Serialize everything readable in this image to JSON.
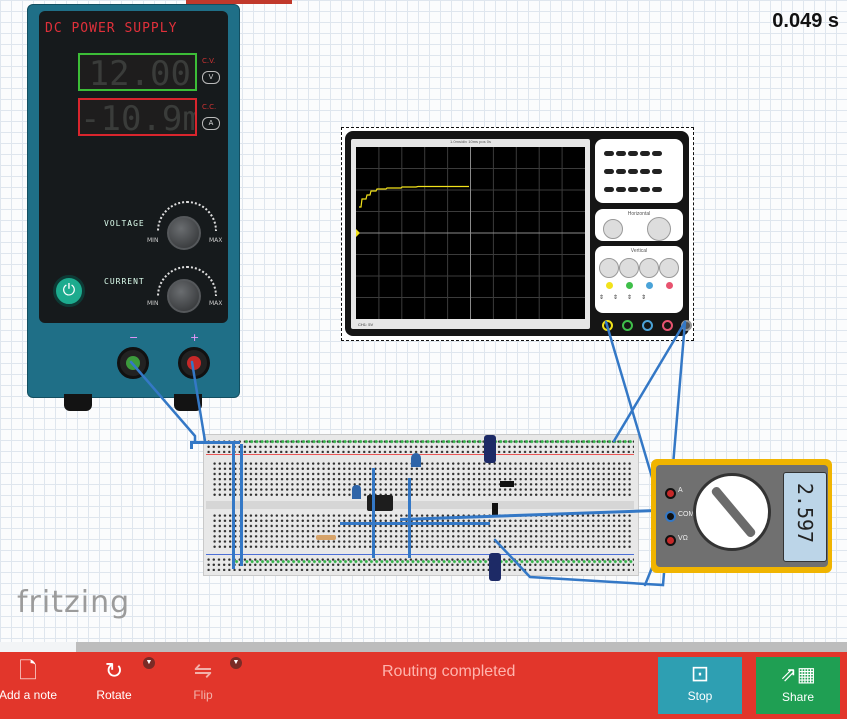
{
  "timer": {
    "value": "0.049 s"
  },
  "power_supply": {
    "title": "DC POWER SUPPLY",
    "voltage_display": "12.00",
    "current_display": "-10.9m",
    "voltage_mode": "C.V.",
    "voltage_unit": "V",
    "current_mode": "C.C.",
    "current_unit": "A",
    "voltage_knob_label": "VOLTAGE",
    "current_knob_label": "CURRENT",
    "min_label": "MIN",
    "max_label": "MAX",
    "minus_label": "−",
    "plus_label": "+",
    "power_icon": "power-icon"
  },
  "oscilloscope": {
    "header": "1.0ms/div  10ms  pos 0s",
    "footer": "CH1: 5V",
    "horizontal_label": "Horizontal",
    "vertical_label": "Vertical",
    "channels": [
      "1",
      "2",
      "3",
      "4"
    ],
    "channel_colors": [
      "#f2e21b",
      "#3fbf4a",
      "#4aa3d8",
      "#e8536f"
    ]
  },
  "multimeter": {
    "reading": "2.597",
    "labels": {
      "amps": "A",
      "com": "COM",
      "volt": "VΩ"
    }
  },
  "logo": {
    "text": "fritzing"
  },
  "toolbar": {
    "add_note": "Add a note",
    "rotate": "Rotate",
    "flip": "Flip",
    "status": "Routing completed",
    "stop": "Stop",
    "share": "Share"
  },
  "colors": {
    "toolbar": "#e2362b",
    "stop_button": "#2e9fb2",
    "share_button": "#1f9f53",
    "wire": "#3478c6"
  }
}
